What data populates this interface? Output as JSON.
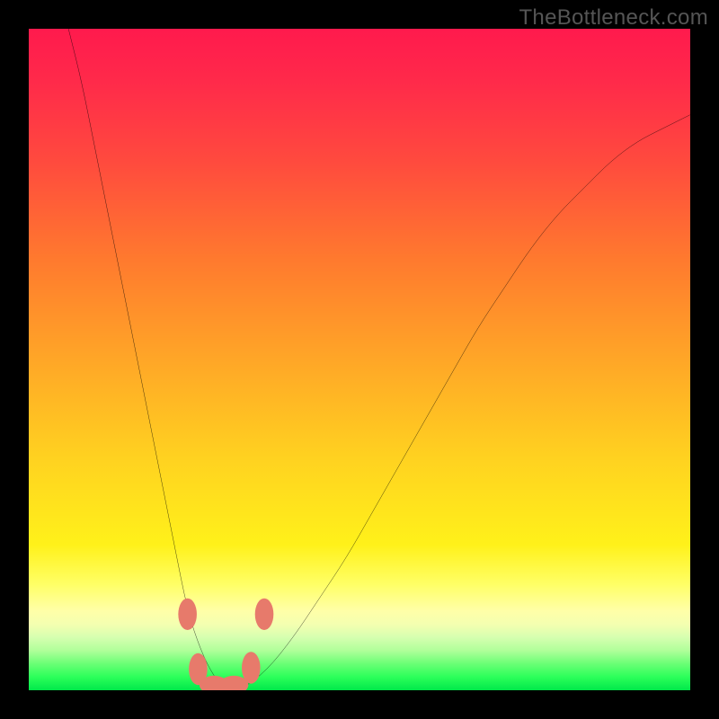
{
  "watermark": "TheBottleneck.com",
  "chart_data": {
    "type": "line",
    "title": "",
    "xlabel": "",
    "ylabel": "",
    "xlim": [
      0,
      100
    ],
    "ylim": [
      0,
      100
    ],
    "grid": false,
    "legend": false,
    "series": [
      {
        "name": "bottleneck-curve",
        "x": [
          6,
          8,
          10,
          12,
          14,
          16,
          18,
          20,
          22,
          24,
          26,
          28,
          30,
          32,
          36,
          40,
          44,
          48,
          52,
          56,
          60,
          64,
          68,
          72,
          76,
          80,
          84,
          88,
          92,
          96,
          100
        ],
        "y": [
          100,
          92,
          82,
          72,
          62,
          52,
          42,
          32,
          22,
          12,
          6,
          2,
          0,
          0,
          3,
          8,
          14,
          20,
          27,
          34,
          41,
          48,
          55,
          61,
          67,
          72,
          76,
          80,
          83,
          85,
          87
        ]
      }
    ],
    "markers": [
      {
        "name": "bead",
        "x": 24.0,
        "y": 11.5,
        "rx": 1.4,
        "ry": 2.4
      },
      {
        "name": "bead",
        "x": 25.6,
        "y": 3.2,
        "rx": 1.4,
        "ry": 2.4
      },
      {
        "name": "bead",
        "x": 28.0,
        "y": 0.8,
        "rx": 2.2,
        "ry": 1.4
      },
      {
        "name": "bead",
        "x": 31.0,
        "y": 0.8,
        "rx": 2.2,
        "ry": 1.4
      },
      {
        "name": "bead",
        "x": 33.6,
        "y": 3.4,
        "rx": 1.4,
        "ry": 2.4
      },
      {
        "name": "bead",
        "x": 35.6,
        "y": 11.5,
        "rx": 1.4,
        "ry": 2.4
      }
    ],
    "gradient_bands": [
      {
        "y": 100,
        "color": "#ff1a4d"
      },
      {
        "y": 50,
        "color": "#ffa627"
      },
      {
        "y": 20,
        "color": "#fff11a"
      },
      {
        "y": 10,
        "color": "#ffffa8"
      },
      {
        "y": 2,
        "color": "#00e84a"
      }
    ]
  }
}
